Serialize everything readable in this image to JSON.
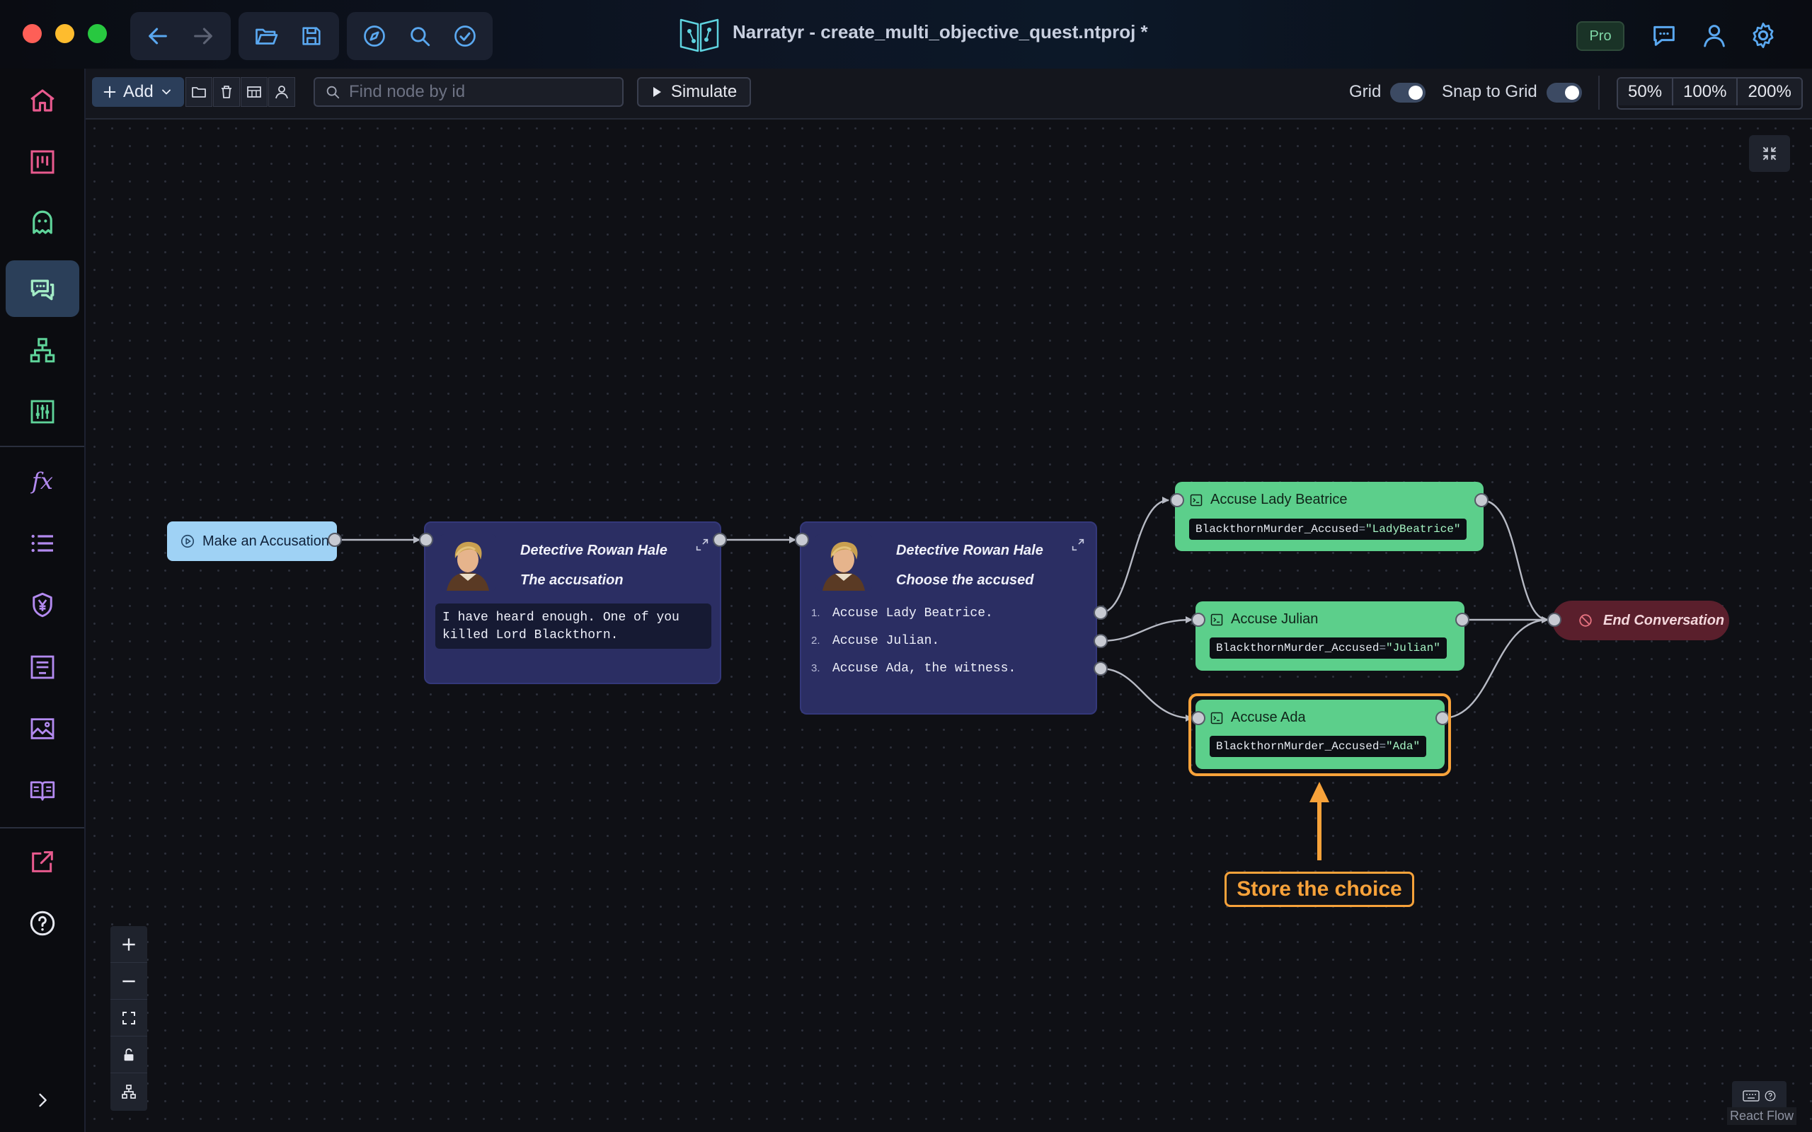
{
  "window": {
    "title": "Narratyr - create_multi_objective_quest.ntproj *",
    "badge": "Pro"
  },
  "sidebar": {
    "items": [
      {
        "name": "home"
      },
      {
        "name": "board"
      },
      {
        "name": "characters"
      },
      {
        "name": "dialogues",
        "active": true
      },
      {
        "name": "hierarchy"
      },
      {
        "name": "settings-sliders"
      },
      {
        "name": "functions",
        "label": "fx"
      },
      {
        "name": "list"
      },
      {
        "name": "currency"
      },
      {
        "name": "document"
      },
      {
        "name": "image"
      },
      {
        "name": "book"
      },
      {
        "name": "export"
      },
      {
        "name": "help"
      }
    ]
  },
  "toolbar": {
    "add_label": "Add",
    "search_placeholder": "Find node by id",
    "simulate_label": "Simulate",
    "grid_label": "Grid",
    "snap_label": "Snap to Grid",
    "grid_on": true,
    "snap_on": true,
    "zoom_levels": [
      "50%",
      "100%",
      "200%"
    ]
  },
  "graph": {
    "start_node": {
      "label": "Make an Accusation"
    },
    "dialog1": {
      "speaker": "Detective Rowan Hale",
      "subtitle": "The accusation",
      "text": "I have heard enough. One of you killed Lord Blackthorn."
    },
    "dialog2": {
      "speaker": "Detective Rowan Hale",
      "subtitle": "Choose the accused",
      "choices": [
        {
          "num": "1.",
          "text": "Accuse Lady Beatrice."
        },
        {
          "num": "2.",
          "text": "Accuse Julian."
        },
        {
          "num": "3.",
          "text": "Accuse Ada, the witness."
        }
      ]
    },
    "instructions": [
      {
        "title": "Accuse Lady Beatrice",
        "var": "BlackthornMurder_Accused",
        "op": "=",
        "value": "\"LadyBeatrice\""
      },
      {
        "title": "Accuse Julian",
        "var": "BlackthornMurder_Accused",
        "op": "=",
        "value": "\"Julian\""
      },
      {
        "title": "Accuse Ada",
        "var": "BlackthornMurder_Accused",
        "op": "=",
        "value": "\"Ada\""
      }
    ],
    "end_node": {
      "label": "End Conversation"
    }
  },
  "callout": {
    "label": "Store the choice",
    "color": "#f7a23a"
  },
  "attribution": "React Flow",
  "colors": {
    "accent": "#f7a23a",
    "instruction": "#5ccf8b",
    "dialog": "#2b2e63",
    "start": "#9fd2f5",
    "end": "#5a1f2c"
  }
}
